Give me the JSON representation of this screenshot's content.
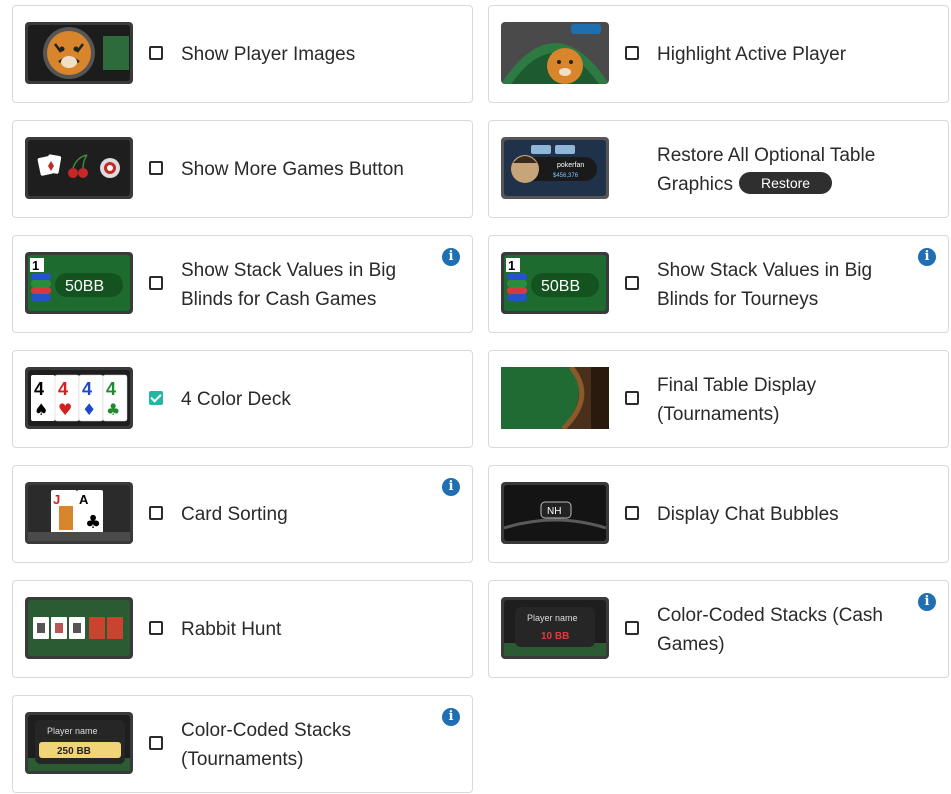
{
  "options": [
    {
      "id": "show-player-images",
      "label": "Show Player Images",
      "checked": false,
      "info": false,
      "thumb": "tiger-avatar"
    },
    {
      "id": "highlight-active-player",
      "label": "Highlight Active Player",
      "checked": false,
      "info": false,
      "thumb": "tiger-table"
    },
    {
      "id": "show-more-games",
      "label": "Show More Games Button",
      "checked": false,
      "info": false,
      "thumb": "games-icons"
    },
    {
      "id": "restore-graphics",
      "label_line1": "Restore All Optional Table",
      "label_line2": "Graphics",
      "button": "Restore",
      "thumb": "player-pokerfan",
      "thumb_name": "pokerfan",
      "thumb_stack": "$456,376"
    },
    {
      "id": "stack-bb-cash",
      "label": "Show Stack Values in Big Blinds for Cash Games",
      "checked": false,
      "info": true,
      "thumb": "chips-bb",
      "thumb_text": "50BB",
      "chip_text": "1"
    },
    {
      "id": "stack-bb-tourney",
      "label": "Show Stack Values in Big Blinds for Tourneys",
      "checked": false,
      "info": true,
      "thumb": "chips-bb",
      "thumb_text": "50BB",
      "chip_text": "1"
    },
    {
      "id": "four-color-deck",
      "label": "4 Color Deck",
      "checked": true,
      "info": false,
      "thumb": "four-cards",
      "card_rank": "4"
    },
    {
      "id": "final-table-display",
      "label": "Final Table Display (Tournaments)",
      "checked": false,
      "info": false,
      "thumb": "felt"
    },
    {
      "id": "card-sorting",
      "label": "Card Sorting",
      "checked": false,
      "info": true,
      "thumb": "jack-ace",
      "card_ranks": [
        "J",
        "A"
      ]
    },
    {
      "id": "display-chat-bubbles",
      "label": "Display Chat Bubbles",
      "checked": false,
      "info": false,
      "thumb": "chat-nh",
      "thumb_text": "NH"
    },
    {
      "id": "rabbit-hunt",
      "label": "Rabbit Hunt",
      "checked": false,
      "info": false,
      "thumb": "rabbit-cards"
    },
    {
      "id": "color-coded-cash",
      "label": "Color-Coded Stacks (Cash Games)",
      "checked": false,
      "info": true,
      "thumb": "stack-red",
      "thumb_name": "Player name",
      "thumb_text": "10 BB"
    },
    {
      "id": "color-coded-tourney",
      "label": "Color-Coded Stacks (Tournaments)",
      "checked": false,
      "info": true,
      "thumb": "stack-yellow",
      "thumb_name": "Player name",
      "thumb_text": "250 BB"
    }
  ],
  "info_glyph": "i",
  "colors": {
    "checkbox_checked": "#27b5a3",
    "info": "#1f6fb2",
    "felt": "#1f6b33"
  }
}
